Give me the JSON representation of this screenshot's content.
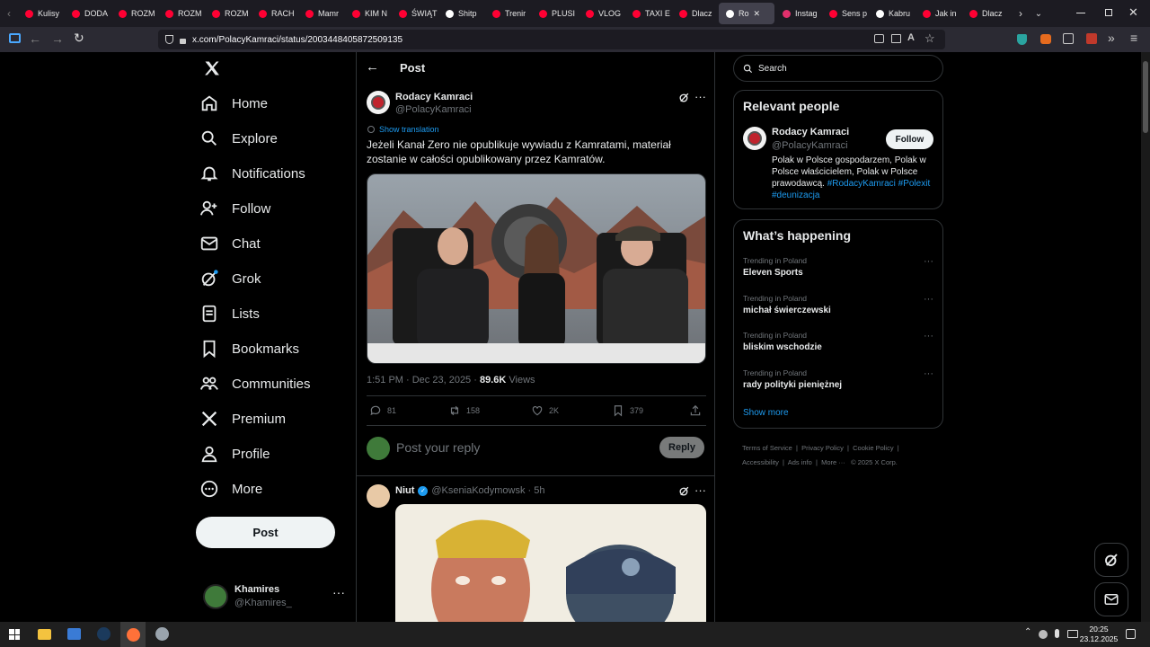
{
  "browser": {
    "tabs": [
      {
        "label": "Kulisy",
        "color": "#ff0033"
      },
      {
        "label": "DODA",
        "color": "#ff0033"
      },
      {
        "label": "ROZM",
        "color": "#ff0033"
      },
      {
        "label": "ROZM",
        "color": "#ff0033"
      },
      {
        "label": "ROZM",
        "color": "#ff0033"
      },
      {
        "label": "RACH",
        "color": "#ff0033"
      },
      {
        "label": "Mamr",
        "color": "#ff0033"
      },
      {
        "label": "KIM N",
        "color": "#ff0033"
      },
      {
        "label": "ŚWIĄT",
        "color": "#ff0033"
      },
      {
        "label": "Shitp",
        "color": "#ffffff"
      },
      {
        "label": "Trenir",
        "color": "#ff0033"
      },
      {
        "label": "PLUSI",
        "color": "#ff0033"
      },
      {
        "label": "VLOG",
        "color": "#ff0033"
      },
      {
        "label": "TAXI E",
        "color": "#ff0033"
      },
      {
        "label": "Dlacz",
        "color": "#ff0033"
      },
      {
        "label": "Ro",
        "color": "#ffffff",
        "active": true
      },
      {
        "label": "Instag",
        "color": "#e1306c"
      },
      {
        "label": "Sens p",
        "color": "#ff0033"
      },
      {
        "label": "Kabru",
        "color": "#ffffff"
      },
      {
        "label": "Jak in",
        "color": "#ff0033"
      },
      {
        "label": "Dlacz",
        "color": "#ff0033"
      }
    ],
    "url": "x.com/PolacyKamraci/status/2003448405872509135"
  },
  "nav": {
    "items": [
      "Home",
      "Explore",
      "Notifications",
      "Follow",
      "Chat",
      "Grok",
      "Lists",
      "Bookmarks",
      "Communities",
      "Premium",
      "Profile",
      "More"
    ],
    "post_button": "Post",
    "account_name": "Khamires",
    "account_handle": "@Khamires_"
  },
  "post": {
    "header_title": "Post",
    "author_name": "Rodacy Kamraci",
    "author_handle": "@PolacyKamraci",
    "show_translation": "Show translation",
    "text": "Jeżeli Kanał Zero nie opublikuje wywiadu z Kamratami, materiał zostanie w całości opublikowany przez Kamratów.",
    "time": "1:51 PM · Dec 23, 2025 · ",
    "views_count": "89.6K",
    "views_label": " Views",
    "replies": "81",
    "reposts": "158",
    "likes": "2K",
    "bookmarks": "379",
    "reply_placeholder": "Post your reply",
    "reply_button": "Reply"
  },
  "reply": {
    "name": "Niut",
    "handle_time": "@KseniaKodymowsk · 5h"
  },
  "search": {
    "placeholder": "Search"
  },
  "relevant": {
    "title": "Relevant people",
    "name": "Rodacy Kamraci",
    "handle": "@PolacyKamraci",
    "follow": "Follow",
    "bio": "Polak w Polsce gospodarzem, Polak w Polsce właścicielem, Polak w Polsce prawodawcą. ",
    "tag1": "#RodacyKamraci",
    "tag2": "#Polexit",
    "tag3": "#deunizacja"
  },
  "happening": {
    "title": "What’s happening",
    "trends": [
      {
        "context": "Trending in Poland",
        "name": "Eleven Sports"
      },
      {
        "context": "Trending in Poland",
        "name": "michał świerczewski"
      },
      {
        "context": "Trending in Poland",
        "name": "bliskim wschodzie"
      },
      {
        "context": "Trending in Poland",
        "name": "rady polityki pieniężnej"
      }
    ],
    "show_more": "Show more"
  },
  "footer": {
    "terms": "Terms of Service",
    "privacy": "Privacy Policy",
    "cookie": "Cookie Policy",
    "accessibility": "Accessibility",
    "ads": "Ads info",
    "more": "More ···",
    "copyright": "© 2025 X Corp."
  },
  "taskbar": {
    "time": "20:25",
    "date": "23.12.2025"
  }
}
